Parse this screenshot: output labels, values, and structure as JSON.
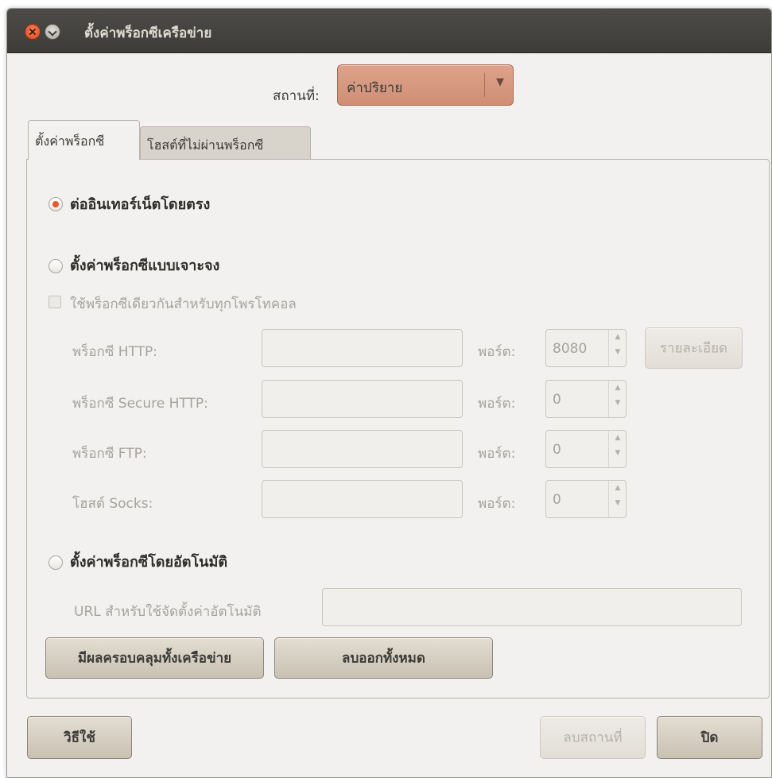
{
  "window": {
    "title": "ตั้งค่าพร็อกซีเครือข่าย"
  },
  "location": {
    "label": "สถานที่:",
    "value": "ค่าปริยาย"
  },
  "tabs": [
    {
      "label": "ตั้งค่าพร็อกซี",
      "active": true
    },
    {
      "label": "โฮสต์ที่ไม่ผ่านพร็อกซี",
      "active": false
    }
  ],
  "options": {
    "direct": "ต่ออินเทอร์เน็ตโดยตรง",
    "manual": "ตั้งค่าพร็อกซีแบบเจาะจง",
    "auto": "ตั้งค่าพร็อกซีโดยอัตโนมัติ"
  },
  "same_proxy_label": "ใช้พร็อกซีเดียวกันสำหรับทุกโพรโทคอล",
  "proxies": [
    {
      "label": "พร็อกซี HTTP:",
      "value": "",
      "port_label": "พอร์ต:",
      "port": "8080"
    },
    {
      "label": "พร็อกซี Secure HTTP:",
      "value": "",
      "port_label": "พอร์ต:",
      "port": "0"
    },
    {
      "label": "พร็อกซี FTP:",
      "value": "",
      "port_label": "พอร์ต:",
      "port": "0"
    },
    {
      "label": "โฮสต์ Socks:",
      "value": "",
      "port_label": "พอร์ต:",
      "port": "0"
    }
  ],
  "details_button": "รายละเอียด",
  "auto_url_label": "URL สำหรับใช้จัดตั้งค่าอัตโนมัติ",
  "apply_system_button": "มีผลครอบคลุมทั้งเครือข่าย",
  "clear_all_button": "ลบออกทั้งหมด",
  "footer": {
    "help_button": "วิธีใช้",
    "delete_location_button": "ลบสถานที่",
    "close_button": "ปิด"
  },
  "icons": {
    "close": "close-icon",
    "minimize": "minimize-icon",
    "dropdown": "chevron-down-icon"
  },
  "colors": {
    "accent": "#e05a2e",
    "combo": "#d9987f",
    "titlebar": "#3d3c38"
  }
}
